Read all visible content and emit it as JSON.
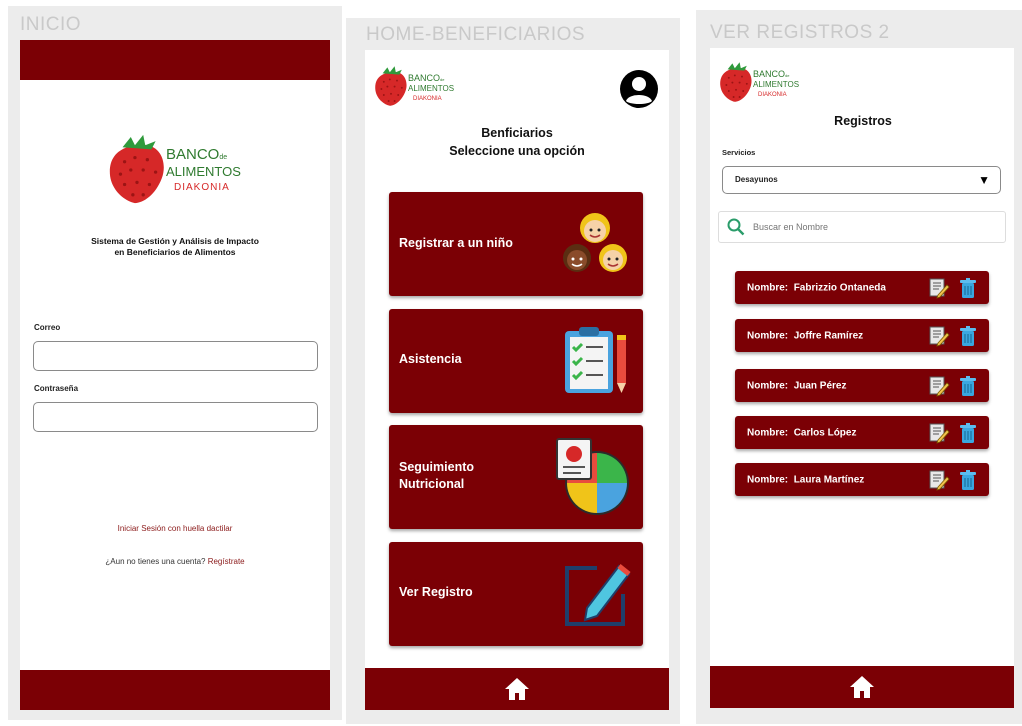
{
  "colors": {
    "brand_red": "#7b0005",
    "logo_red": "#d62828",
    "link_red": "#8b1a1a"
  },
  "screens": {
    "inicio": {
      "frame_title": "INICIO",
      "logo": {
        "line1": "BANCO",
        "de": "de",
        "line2": "ALIMENTOS",
        "line3": "DIAKONIA"
      },
      "subtitle_line1": "Sistema de Gestión y Análisis de Impacto",
      "subtitle_line2": "en Beneficiarios de Alimentos",
      "email_label": "Correo",
      "email_value": "",
      "password_label": "Contraseña",
      "password_value": "",
      "fingerprint_link": "Iniciar Sesión con huella dactilar",
      "no_account_text": "¿Aun no tienes una cuenta?",
      "register_link": "Regístrate"
    },
    "home": {
      "frame_title": "HOME-BENEFICIARIOS",
      "logo": {
        "line1": "BANCO",
        "de": "de",
        "line2": "ALIMENTOS",
        "line3": "DIAKONIA"
      },
      "heading_line1": "Benficiarios",
      "heading_line2": "Seleccione una opción",
      "profile_icon": "user-circle-icon",
      "menu": [
        {
          "label": "Registrar a un niño",
          "icon": "children-icon"
        },
        {
          "label": "Asistencia",
          "icon": "clipboard-checklist-icon"
        },
        {
          "label": "Seguimiento\nNutricional",
          "icon": "nutrition-chart-icon"
        },
        {
          "label": "Ver Registro",
          "icon": "edit-pencil-icon"
        }
      ],
      "home_icon": "home-icon"
    },
    "registros": {
      "frame_title": "VER REGISTROS 2",
      "logo": {
        "line1": "BANCO",
        "de": "de",
        "line2": "ALIMENTOS",
        "line3": "DIAKONIA"
      },
      "heading": "Registros",
      "services_label": "Servicios",
      "services_selected": "Desayunos",
      "search_placeholder": "Buscar en Nombre",
      "rows": [
        {
          "prefix": "Nombre:",
          "name": "Fabrizzio Ontaneda"
        },
        {
          "prefix": "Nombre:",
          "name": "Joffre Ramírez"
        },
        {
          "prefix": "Nombre:",
          "name": "Juan Pérez"
        },
        {
          "prefix": "Nombre:",
          "name": "Carlos López"
        },
        {
          "prefix": "Nombre:",
          "name": "Laura Martínez"
        }
      ],
      "home_icon": "home-icon"
    }
  }
}
